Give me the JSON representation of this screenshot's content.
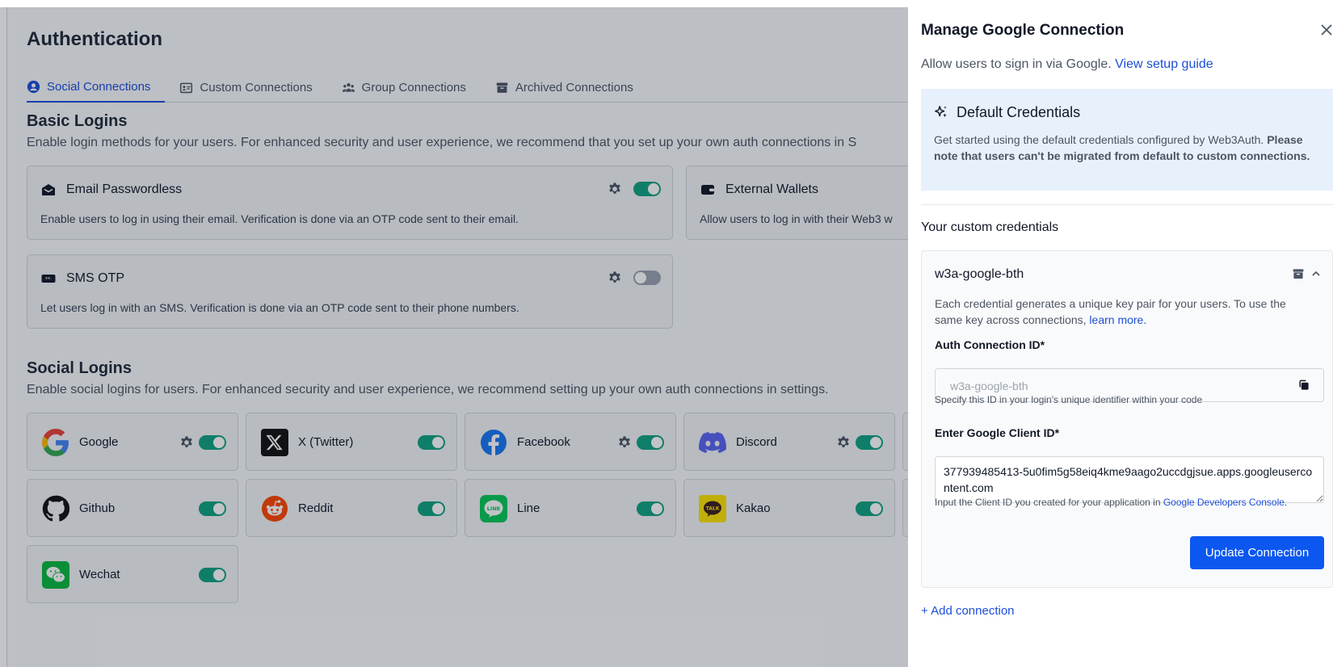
{
  "page": {
    "title": "Authentication",
    "tabs": [
      {
        "label": "Social Connections",
        "icon": "user-circle-icon"
      },
      {
        "label": "Custom Connections",
        "icon": "id-card-icon"
      },
      {
        "label": "Group Connections",
        "icon": "users-icon"
      },
      {
        "label": "Archived Connections",
        "icon": "archive-icon"
      }
    ],
    "basic": {
      "title": "Basic Logins",
      "desc": "Enable login methods for your users. For enhanced security and user experience, we recommend that you set up your own auth connections in S",
      "cards": [
        {
          "title": "Email Passwordless",
          "desc": "Enable users to log in using their email. Verification is done via an OTP code sent to their email.",
          "enabled": true
        },
        {
          "title": "External Wallets",
          "desc": "Allow users to log in with their Web3 w"
        },
        {
          "title": "SMS OTP",
          "desc": "Let users log in with an SMS. Verification is done via an OTP code sent to their phone numbers.",
          "enabled": false
        }
      ]
    },
    "social": {
      "title": "Social Logins",
      "desc": "Enable social logins for users. For enhanced security and user experience, we recommend setting up your own auth connections in settings.",
      "items": [
        {
          "name": "Google",
          "settings": true,
          "enabled": true
        },
        {
          "name": "X (Twitter)",
          "settings": false,
          "enabled": true
        },
        {
          "name": "Facebook",
          "settings": true,
          "enabled": true
        },
        {
          "name": "Discord",
          "settings": true,
          "enabled": true
        },
        {
          "name": "Github",
          "settings": false,
          "enabled": true
        },
        {
          "name": "Reddit",
          "settings": false,
          "enabled": true
        },
        {
          "name": "Line",
          "settings": false,
          "enabled": true
        },
        {
          "name": "Kakao",
          "settings": false,
          "enabled": true
        },
        {
          "name": "Wechat",
          "settings": false,
          "enabled": true
        }
      ]
    }
  },
  "drawer": {
    "title": "Manage Google Connection",
    "subtitle": "Allow users to sign in via Google.",
    "setup_link": "View setup guide",
    "default": {
      "title": "Default Credentials",
      "desc": "Get started using the default credentials configured by Web3Auth.",
      "note": "Please note that users can't be migrated from default to custom connections."
    },
    "custom_heading": "Your custom credentials",
    "credential": {
      "name": "w3a-google-bth",
      "text": "Each credential generates a unique key pair for your users. To use the same key across connections,",
      "learn_more": "learn more.",
      "auth_id_label": "Auth Connection ID*",
      "auth_id_value": "w3a-google-bth",
      "auth_id_hint": "Specify this ID in your login's unique identifier within your code",
      "client_id_label": "Enter Google Client ID*",
      "client_id_value": "377939485413-5u0fim5g58eiq4kme9aago2uccdgjsue.apps.googleusercontent.com",
      "client_id_hint": "Input the Client ID you created for your application in",
      "console_link": "Google Developers Console.",
      "update_button": "Update Connection"
    },
    "add_connection": "+ Add connection"
  },
  "colors": {
    "accent": "#1d4ed8",
    "toggle_on": "#10a37f",
    "primary_button": "#0b57f0",
    "info_bg": "#e7f1fb"
  }
}
